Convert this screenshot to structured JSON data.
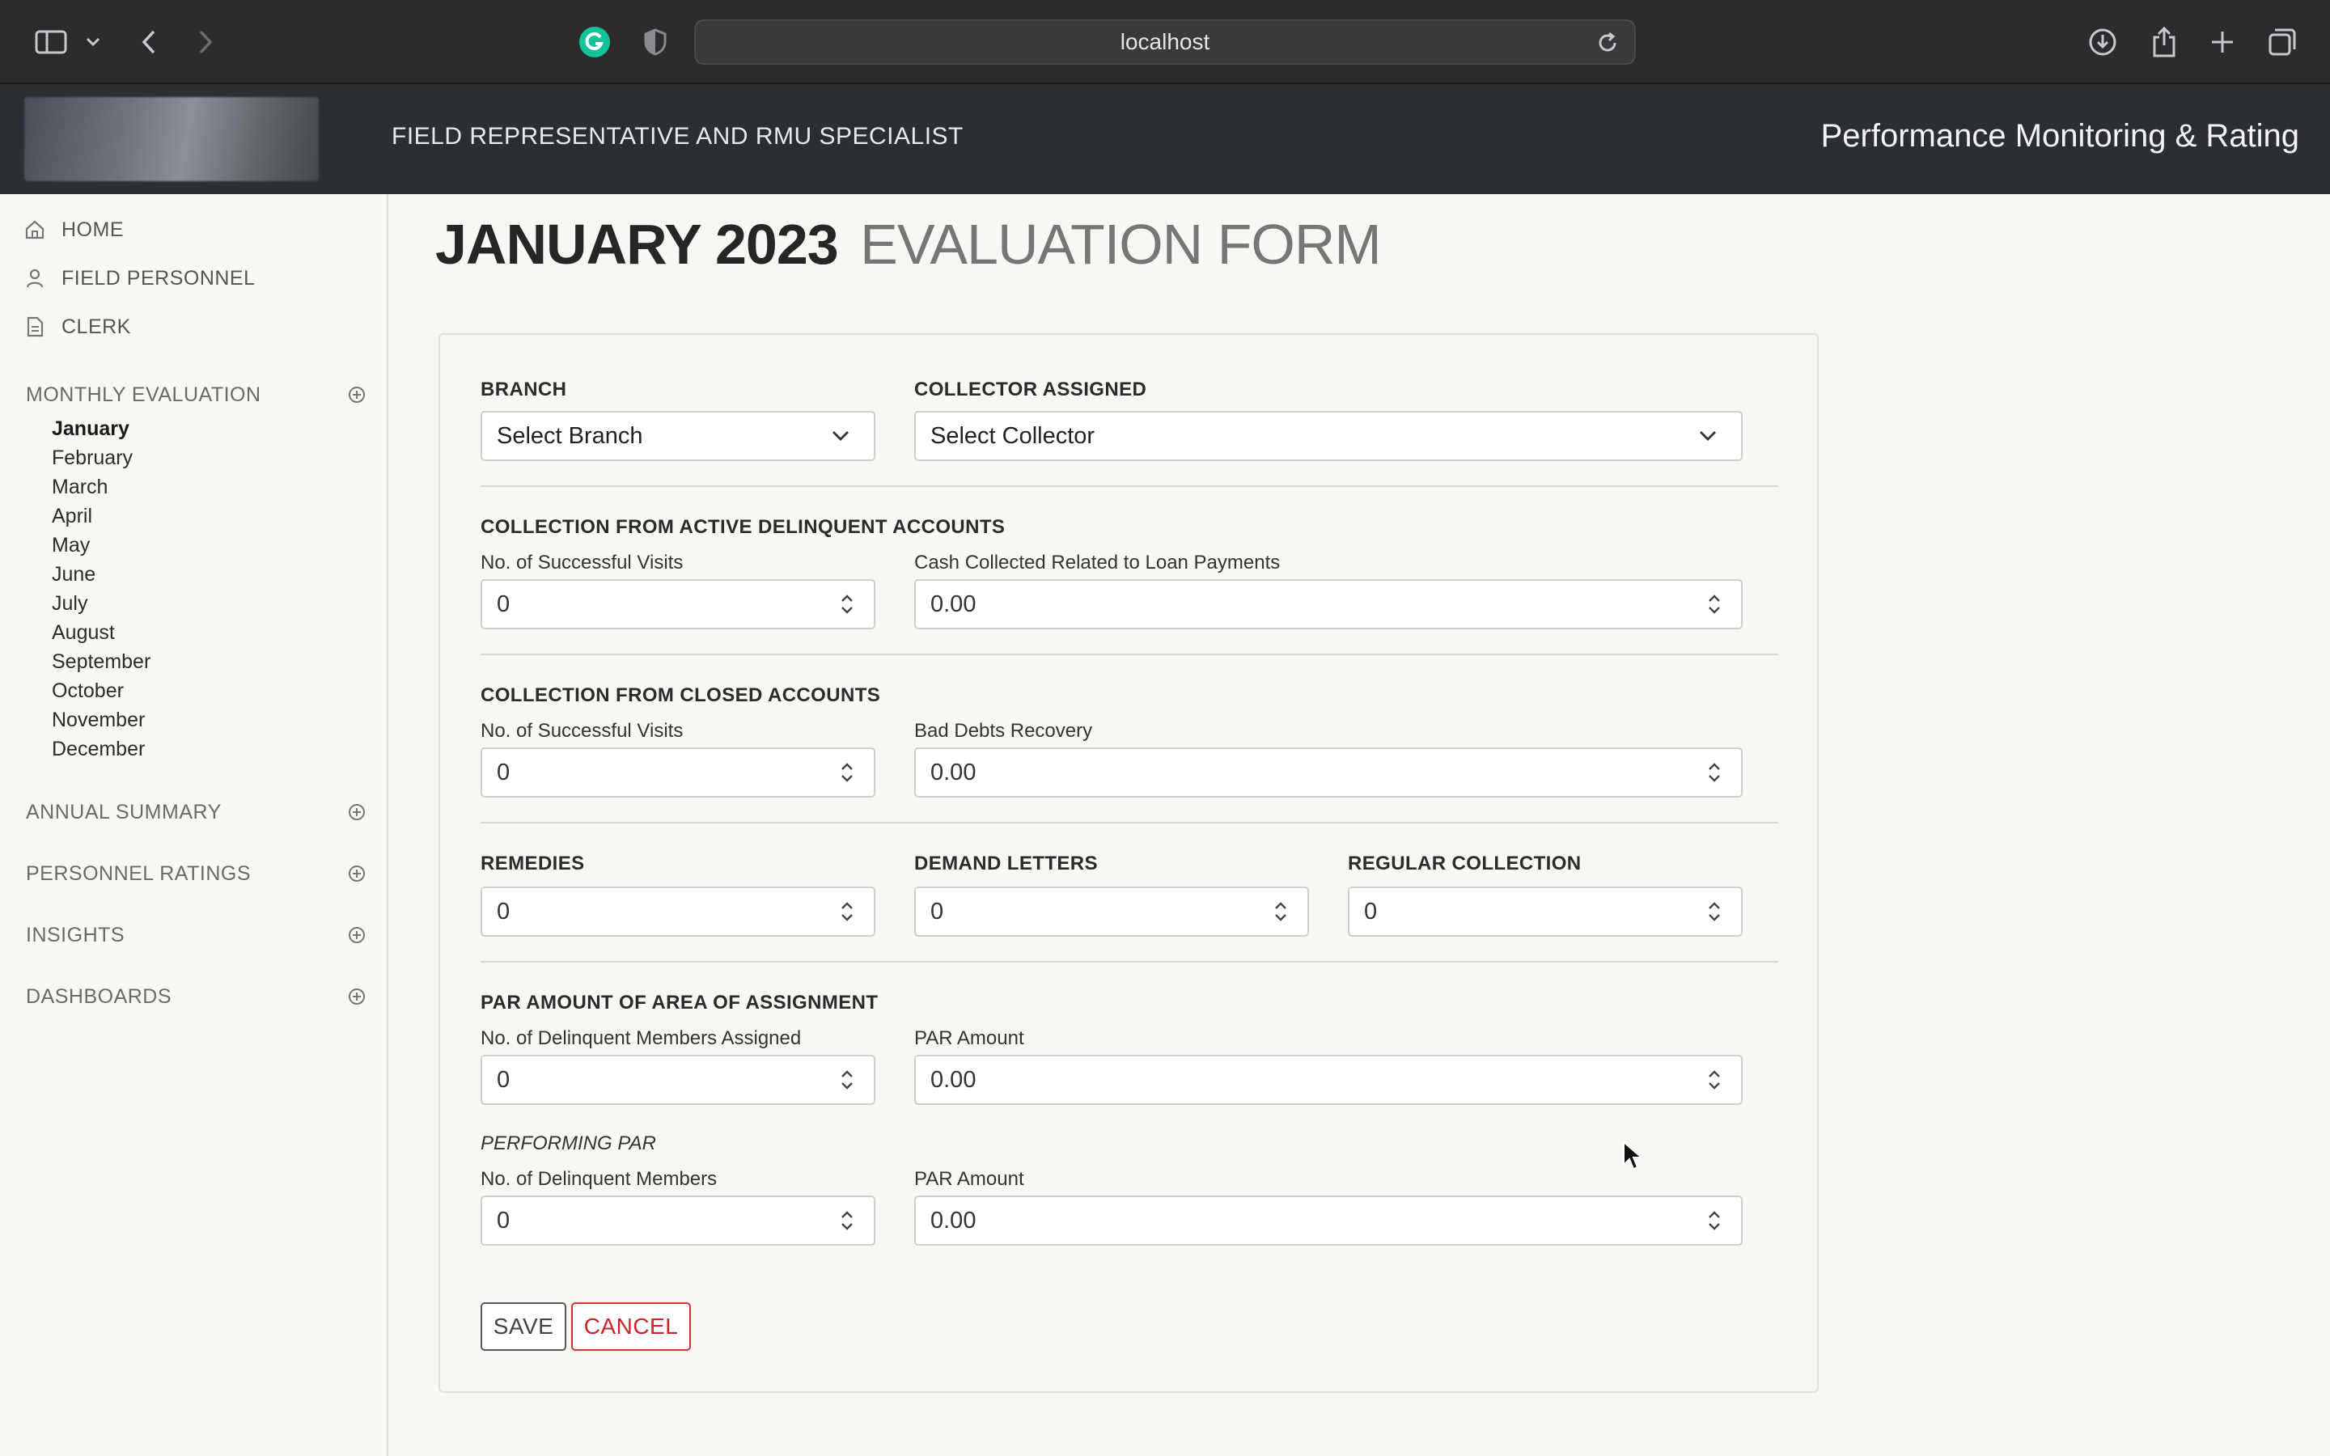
{
  "browser": {
    "url": "localhost"
  },
  "header": {
    "role_title": "FIELD REPRESENTATIVE AND RMU SPECIALIST",
    "app_title": "Performance Monitoring & Rating"
  },
  "sidebar": {
    "nav": [
      {
        "label": "HOME",
        "icon": "home-icon"
      },
      {
        "label": "FIELD PERSONNEL",
        "icon": "person-icon"
      },
      {
        "label": "CLERK",
        "icon": "document-icon"
      }
    ],
    "monthly_evaluation": {
      "label": "MONTHLY EVALUATION",
      "months": [
        "January",
        "February",
        "March",
        "April",
        "May",
        "June",
        "July",
        "August",
        "September",
        "October",
        "November",
        "December"
      ],
      "active_month": "January"
    },
    "sections": [
      {
        "label": "ANNUAL SUMMARY"
      },
      {
        "label": "PERSONNEL RATINGS"
      },
      {
        "label": "INSIGHTS"
      },
      {
        "label": "DASHBOARDS"
      }
    ]
  },
  "page": {
    "title_strong": "JANUARY 2023",
    "title_light": "EVALUATION FORM"
  },
  "form": {
    "branch": {
      "label": "BRANCH",
      "value": "Select Branch"
    },
    "collector": {
      "label": "COLLECTOR ASSIGNED",
      "value": "Select Collector"
    },
    "active_delinquent": {
      "heading": "COLLECTION FROM ACTIVE DELINQUENT ACCOUNTS",
      "visits_label": "No. of Successful Visits",
      "visits_value": "0",
      "cash_label": "Cash Collected Related to Loan Payments",
      "cash_value": "0.00"
    },
    "closed_accounts": {
      "heading": "COLLECTION FROM CLOSED ACCOUNTS",
      "visits_label": "No. of Successful Visits",
      "visits_value": "0",
      "recovery_label": "Bad Debts Recovery",
      "recovery_value": "0.00"
    },
    "remedies": {
      "label": "REMEDIES",
      "value": "0"
    },
    "demand_letters": {
      "label": "DEMAND LETTERS",
      "value": "0"
    },
    "regular_collection": {
      "label": "REGULAR COLLECTION",
      "value": "0"
    },
    "par_area": {
      "heading": "PAR AMOUNT OF AREA OF ASSIGNMENT",
      "members_label": "No. of Delinquent Members Assigned",
      "members_value": "0",
      "amount_label": "PAR Amount",
      "amount_value": "0.00"
    },
    "performing_par": {
      "heading": "PERFORMING PAR",
      "members_label": "No. of Delinquent Members",
      "members_value": "0",
      "amount_label": "PAR Amount",
      "amount_value": "0.00"
    },
    "save_label": "SAVE",
    "cancel_label": "CANCEL"
  },
  "colors": {
    "header_bg": "#2b2f34",
    "page_bg": "#f7f7f3",
    "cancel_red": "#c9232c"
  }
}
